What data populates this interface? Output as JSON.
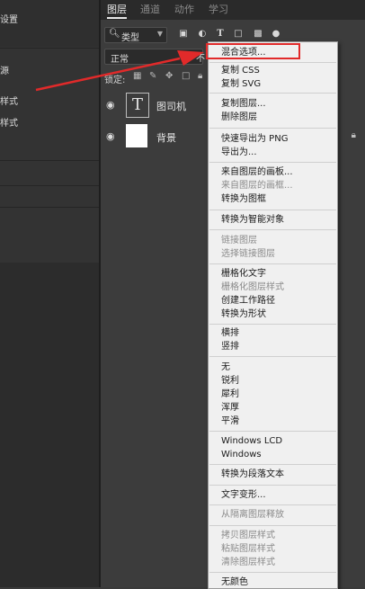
{
  "left_panel": {
    "labels": [
      "设置",
      "源",
      "样式",
      "样式"
    ]
  },
  "tabs": [
    "图层",
    "通道",
    "动作",
    "学习"
  ],
  "filter": {
    "kind_label": "类型"
  },
  "blend": {
    "mode": "正常",
    "opacity_label": "不"
  },
  "lock": {
    "label": "锁定:"
  },
  "layers": [
    {
      "name": "图司机",
      "thumb": "T",
      "type": "text"
    },
    {
      "name": "背景",
      "type": "background"
    }
  ],
  "menu": {
    "items": [
      {
        "label": "混合选项...",
        "disabled": false
      },
      {
        "label": "复制 CSS",
        "disabled": false
      },
      {
        "label": "复制 SVG",
        "disabled": false
      },
      {
        "label": "复制图层...",
        "disabled": false
      },
      {
        "label": "删除图层",
        "disabled": false
      },
      {
        "label": "快速导出为 PNG",
        "disabled": false
      },
      {
        "label": "导出为...",
        "disabled": false
      },
      {
        "label": "来自图层的画板...",
        "disabled": false
      },
      {
        "label": "来自图层的画框...",
        "disabled": true
      },
      {
        "label": "转换为图框",
        "disabled": false
      },
      {
        "label": "转换为智能对象",
        "disabled": false
      },
      {
        "label": "链接图层",
        "disabled": true
      },
      {
        "label": "选择链接图层",
        "disabled": true
      },
      {
        "label": "栅格化文字",
        "disabled": false
      },
      {
        "label": "栅格化图层样式",
        "disabled": true
      },
      {
        "label": "创建工作路径",
        "disabled": false
      },
      {
        "label": "转换为形状",
        "disabled": false
      },
      {
        "label": "横排",
        "disabled": false
      },
      {
        "label": "竖排",
        "disabled": false
      },
      {
        "label": "无",
        "disabled": false
      },
      {
        "label": "锐利",
        "disabled": false
      },
      {
        "label": "犀利",
        "disabled": false
      },
      {
        "label": "浑厚",
        "disabled": false
      },
      {
        "label": "平滑",
        "disabled": false
      },
      {
        "label": "Windows LCD",
        "disabled": false
      },
      {
        "label": "Windows",
        "disabled": false
      },
      {
        "label": "转换为段落文本",
        "disabled": false
      },
      {
        "label": "文字变形...",
        "disabled": false
      },
      {
        "label": "从隔离图层释放",
        "disabled": true
      },
      {
        "label": "拷贝图层样式",
        "disabled": true
      },
      {
        "label": "粘贴图层样式",
        "disabled": true
      },
      {
        "label": "清除图层样式",
        "disabled": true
      },
      {
        "label": "无颜色",
        "disabled": false
      }
    ]
  },
  "annotation": {
    "color": "#e12a2a"
  }
}
